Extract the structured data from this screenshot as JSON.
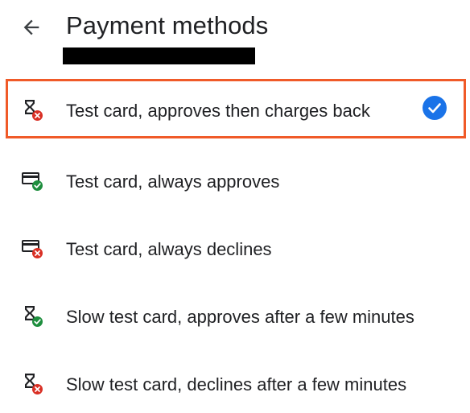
{
  "header": {
    "title": "Payment methods"
  },
  "colors": {
    "accent": "#1a73e8",
    "success": "#1e8e3e",
    "error": "#d93025",
    "selection_outline": "#f05a28"
  },
  "payment_methods": [
    {
      "label": "Test card, approves then charges back",
      "icon": "hourglass-icon",
      "badge": "error-badge",
      "selected": true
    },
    {
      "label": "Test card, always approves",
      "icon": "credit-card-icon",
      "badge": "success-badge",
      "selected": false
    },
    {
      "label": "Test card, always declines",
      "icon": "credit-card-icon",
      "badge": "error-badge",
      "selected": false
    },
    {
      "label": "Slow test card, approves after a few minutes",
      "icon": "hourglass-icon",
      "badge": "success-badge",
      "selected": false
    },
    {
      "label": "Slow test card, declines after a few minutes",
      "icon": "hourglass-icon",
      "badge": "error-badge",
      "selected": false
    }
  ]
}
